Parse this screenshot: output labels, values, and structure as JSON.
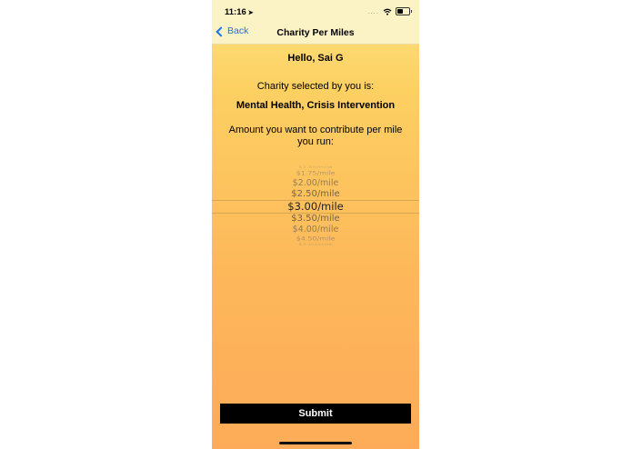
{
  "status_bar": {
    "time": "11:16",
    "location_arrow": "➤",
    "signal_dots": "....",
    "wifi_icon": "wifi-icon",
    "battery_icon": "battery-icon"
  },
  "nav": {
    "back_label": "Back",
    "title": "Charity Per Miles"
  },
  "main": {
    "greeting": "Hello, Sai G",
    "charity_label": "Charity selected by you is:",
    "charity_name": "Mental Health, Crisis Intervention",
    "amount_label": "Amount you want to contribute per mile you run:"
  },
  "picker": {
    "items": [
      "$1.50/mile",
      "$1.75/mile",
      "$2.00/mile",
      "$2.50/mile",
      "$3.00/mile",
      "$3.50/mile",
      "$4.00/mile",
      "$4.50/mile",
      "$5.00/mile"
    ],
    "selected": "$3.00/mile"
  },
  "submit_label": "Submit",
  "colors": {
    "background_top": "#fde27e",
    "background_bottom": "#fdab58",
    "accent_blue": "#1a73e8",
    "button": "#000000"
  }
}
